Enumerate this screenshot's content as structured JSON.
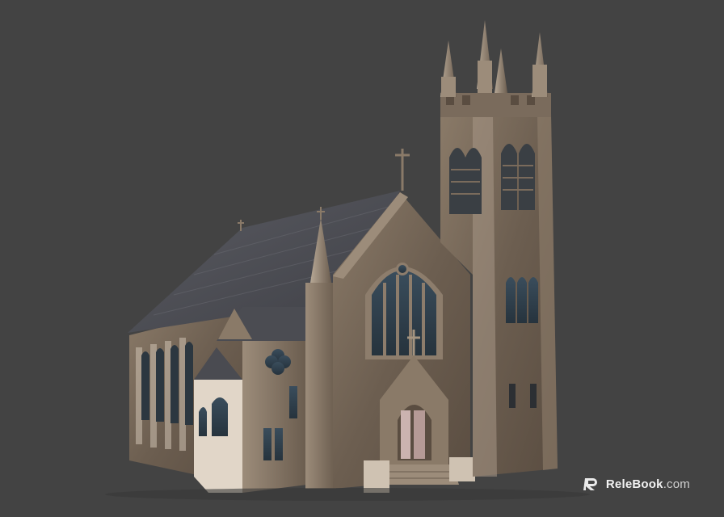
{
  "scene": {
    "subject": "church-3d-model",
    "background_color": "#434343",
    "stone_color": "#6f6254",
    "stone_light": "#9a8a78",
    "roof_color": "#4b4c52",
    "window_color": "#31414d"
  },
  "watermark": {
    "logo_icon": "relebook-r-icon",
    "brand": "ReleBook",
    "domain": ".com"
  }
}
